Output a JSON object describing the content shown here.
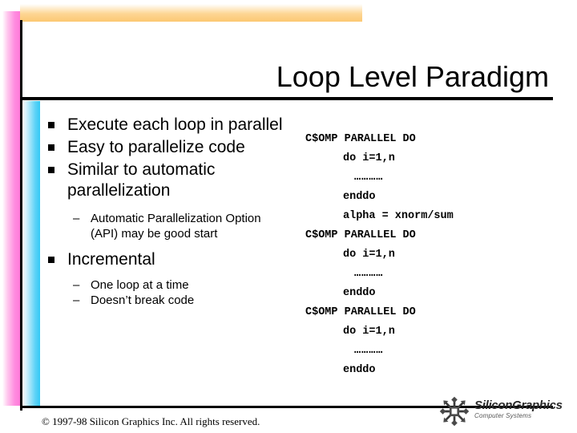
{
  "slide": {
    "title": "Loop Level Paradigm",
    "accents": {
      "orange": "#fcc872",
      "pink": "#ff8ce0",
      "blue": "#33c9f5",
      "rule": "#000000"
    }
  },
  "bullets": [
    {
      "level": 1,
      "text": "Execute each loop in parallel"
    },
    {
      "level": 1,
      "text": "Easy to parallelize code"
    },
    {
      "level": 1,
      "text": "Similar to automatic parallelization"
    },
    {
      "level": 2,
      "marker": "–",
      "text": "Automatic Parallelization Option (API)  may be good start"
    },
    {
      "level": 1,
      "text": "Incremental"
    },
    {
      "level": 2,
      "marker": "–",
      "text": "One loop at a time"
    },
    {
      "level": 2,
      "marker": "–",
      "text": "Doesn’t break code"
    }
  ],
  "code": {
    "lines": [
      {
        "indent": 0,
        "text": "C$OMP PARALLEL DO"
      },
      {
        "indent": 1,
        "text": "do i=1,n"
      },
      {
        "indent": 2,
        "text": "…………"
      },
      {
        "indent": 1,
        "text": "enddo"
      },
      {
        "indent": 1,
        "text": "alpha = xnorm/sum"
      },
      {
        "indent": 0,
        "text": "C$OMP PARALLEL DO"
      },
      {
        "indent": 1,
        "text": "do i=1,n"
      },
      {
        "indent": 2,
        "text": "…………"
      },
      {
        "indent": 1,
        "text": "enddo"
      },
      {
        "indent": 0,
        "text": "C$OMP PARALLEL DO"
      },
      {
        "indent": 1,
        "text": "do i=1,n"
      },
      {
        "indent": 2,
        "text": "…………"
      },
      {
        "indent": 1,
        "text": "enddo"
      }
    ]
  },
  "footer": {
    "copyright": "© 1997-98 Silicon Graphics Inc. All rights reserved.",
    "logo_name": "SiliconGraphics",
    "logo_subtitle": "Computer Systems",
    "logo_icon": "sgi-cube-logo"
  }
}
